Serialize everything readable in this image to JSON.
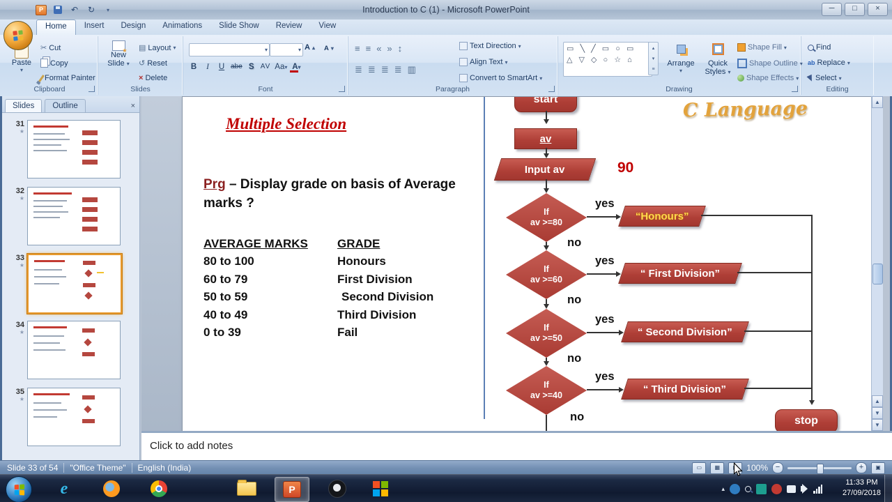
{
  "window": {
    "title": "Introduction to C (1) - Microsoft PowerPoint"
  },
  "icons": {
    "dropdown": "▾",
    "minimize": "─",
    "maximize": "□",
    "close": "×",
    "undo": "↶",
    "redo": "↻",
    "cut": "✂",
    "star": "★",
    "scroll_up": "▲",
    "scroll_down": "▼",
    "tray_expand": "▴",
    "bullets": "≡",
    "numbering": "≡",
    "indent_dec": "«",
    "indent_inc": "»",
    "line_spacing": "↕",
    "align": "≣",
    "columns": "▥",
    "layout": "▤",
    "reset": "↺",
    "delete": "×",
    "grow": "A",
    "shrink": "A",
    "shapes_row1": "▭ ╲ ╱ ▭ ○ ▭",
    "shapes_row2": "△ ▽ ◇ ○ ☆ ⌂",
    "view_normal": "▭",
    "view_sorter": "▦",
    "view_slideshow": "▶",
    "zoom_out": "−",
    "zoom_in": "+",
    "fit": "▣"
  },
  "ribbon": {
    "tabs": [
      {
        "label": "Home"
      },
      {
        "label": "Insert"
      },
      {
        "label": "Design"
      },
      {
        "label": "Animations"
      },
      {
        "label": "Slide Show"
      },
      {
        "label": "Review"
      },
      {
        "label": "View"
      }
    ],
    "clipboard": {
      "title": "Clipboard",
      "paste": "Paste",
      "cut": "Cut",
      "copy": "Copy",
      "format_painter": "Format Painter"
    },
    "slides": {
      "title": "Slides",
      "new_slide_1": "New",
      "new_slide_2": "Slide",
      "layout": "Layout",
      "reset": "Reset",
      "delete": "Delete"
    },
    "font": {
      "title": "Font",
      "bold": "B",
      "italic": "I",
      "underline": "U",
      "strike": "abe",
      "shadow": "S",
      "spacing": "AV",
      "case": "Aa",
      "color": "A"
    },
    "paragraph": {
      "title": "Paragraph",
      "text_direction": "Text Direction",
      "align_text": "Align Text",
      "smartart": "Convert to SmartArt"
    },
    "drawing": {
      "title": "Drawing",
      "arrange": "Arrange",
      "quick1": "Quick",
      "quick2": "Styles",
      "shape_fill": "Shape Fill",
      "shape_outline": "Shape Outline",
      "shape_effects": "Shape Effects"
    },
    "editing": {
      "title": "Editing",
      "find": "Find",
      "replace": "Replace",
      "select": "Select"
    }
  },
  "slides_panel": {
    "slides_tab": "Slides",
    "outline_tab": "Outline",
    "thumbnails": [
      {
        "number": "31"
      },
      {
        "number": "32"
      },
      {
        "number": "33"
      },
      {
        "number": "34"
      },
      {
        "number": "35"
      }
    ]
  },
  "slide": {
    "watermark": "C Language",
    "title": "Multiple Selection",
    "prg_label": "Prg",
    "prg_rest": " – Display grade on basis of Average marks ?",
    "value_annotation": "90",
    "table": {
      "col1_header": "AVERAGE MARKS",
      "col2_header": "GRADE",
      "rows": [
        {
          "marks": "80 to 100",
          "grade": "Honours"
        },
        {
          "marks": "60 to 79",
          "grade": "First Division"
        },
        {
          "marks": "50 to 59",
          "grade": "Second Division"
        },
        {
          "marks": "40 to 49",
          "grade": "Third Division"
        },
        {
          "marks": "0 to 39",
          "grade": "Fail"
        }
      ]
    },
    "flowchart": {
      "start": "start",
      "declare": "av",
      "input": "Input av",
      "stop": "stop",
      "decisions": [
        {
          "cond1": "If",
          "cond2": "av >=80",
          "yes": "yes",
          "no": "no",
          "result": "“Honours”"
        },
        {
          "cond1": "If",
          "cond2": "av >=60",
          "yes": "yes",
          "no": "no",
          "result": "“ First Division”"
        },
        {
          "cond1": "If",
          "cond2": "av >=50",
          "yes": "yes",
          "no": "no",
          "result": "“ Second Division”"
        },
        {
          "cond1": "If",
          "cond2": "av >=40",
          "yes": "yes",
          "no": "no",
          "result": "“ Third Division”"
        }
      ]
    }
  },
  "notes": {
    "placeholder": "Click to add notes"
  },
  "status_bar": {
    "slide_indicator": "Slide 33 of 54",
    "theme": "\"Office Theme\"",
    "language": "English (India)",
    "zoom": "100%"
  },
  "taskbar": {
    "time": "11:33 PM",
    "date": "27/09/2018"
  }
}
